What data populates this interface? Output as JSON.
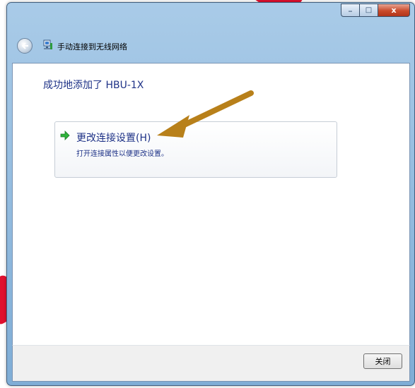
{
  "window": {
    "nav_title": "手动连接到无线网络",
    "minimize_glyph": "_",
    "maximize_glyph": "□",
    "close_glyph": "x"
  },
  "content": {
    "success_message": "成功地添加了 HBU-1X",
    "link": {
      "title": "更改连接设置(H)",
      "description": "打开连接属性以便更改设置。"
    }
  },
  "footer": {
    "close_label": "关闭"
  },
  "icons": {
    "back": "back-arrow-icon",
    "network": "network-icon",
    "link_arrow": "green-arrow-icon"
  },
  "colors": {
    "link_text": "#1e3287",
    "annotation_arrow": "#b8801a",
    "background_mark": "#e0102e"
  }
}
